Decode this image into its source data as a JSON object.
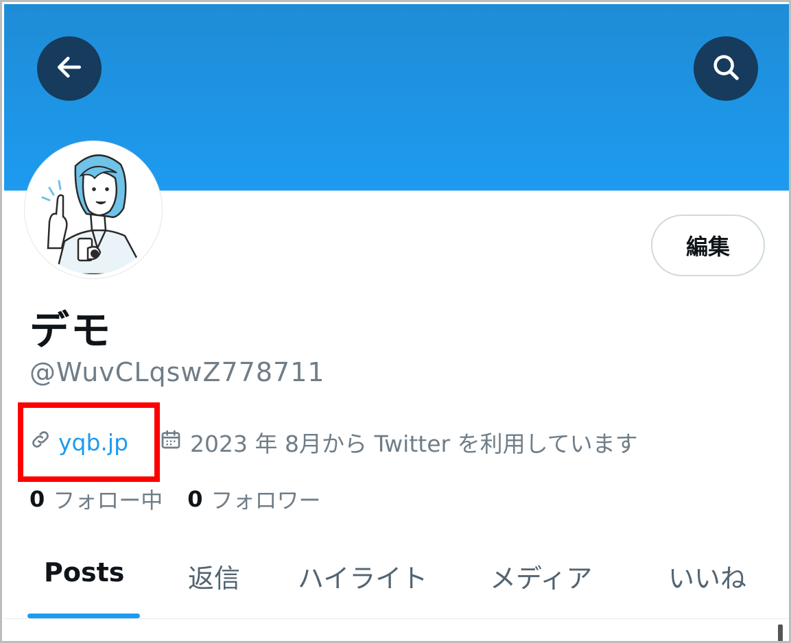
{
  "header": {
    "back_icon": "arrow-left-icon",
    "search_icon": "search-icon",
    "banner_color": "#1d9bf0"
  },
  "profile": {
    "display_name": "デモ",
    "handle": "@WuvCLqswZ778711",
    "edit_label": "編集",
    "link": "yqb.jp",
    "joined": "2023 年 8月から Twitter を利用しています",
    "following_count": "0",
    "following_label": "フォロー中",
    "followers_count": "0",
    "followers_label": "フォロワー"
  },
  "tabs": [
    {
      "label": "Posts"
    },
    {
      "label": "返信"
    },
    {
      "label": "ハイライト"
    },
    {
      "label": "メディア"
    },
    {
      "label": "いいね"
    }
  ],
  "colors": {
    "accent": "#1d9bf0",
    "highlight": "#ff0000",
    "text_primary": "#0f1419",
    "text_secondary": "#6f7d88"
  }
}
